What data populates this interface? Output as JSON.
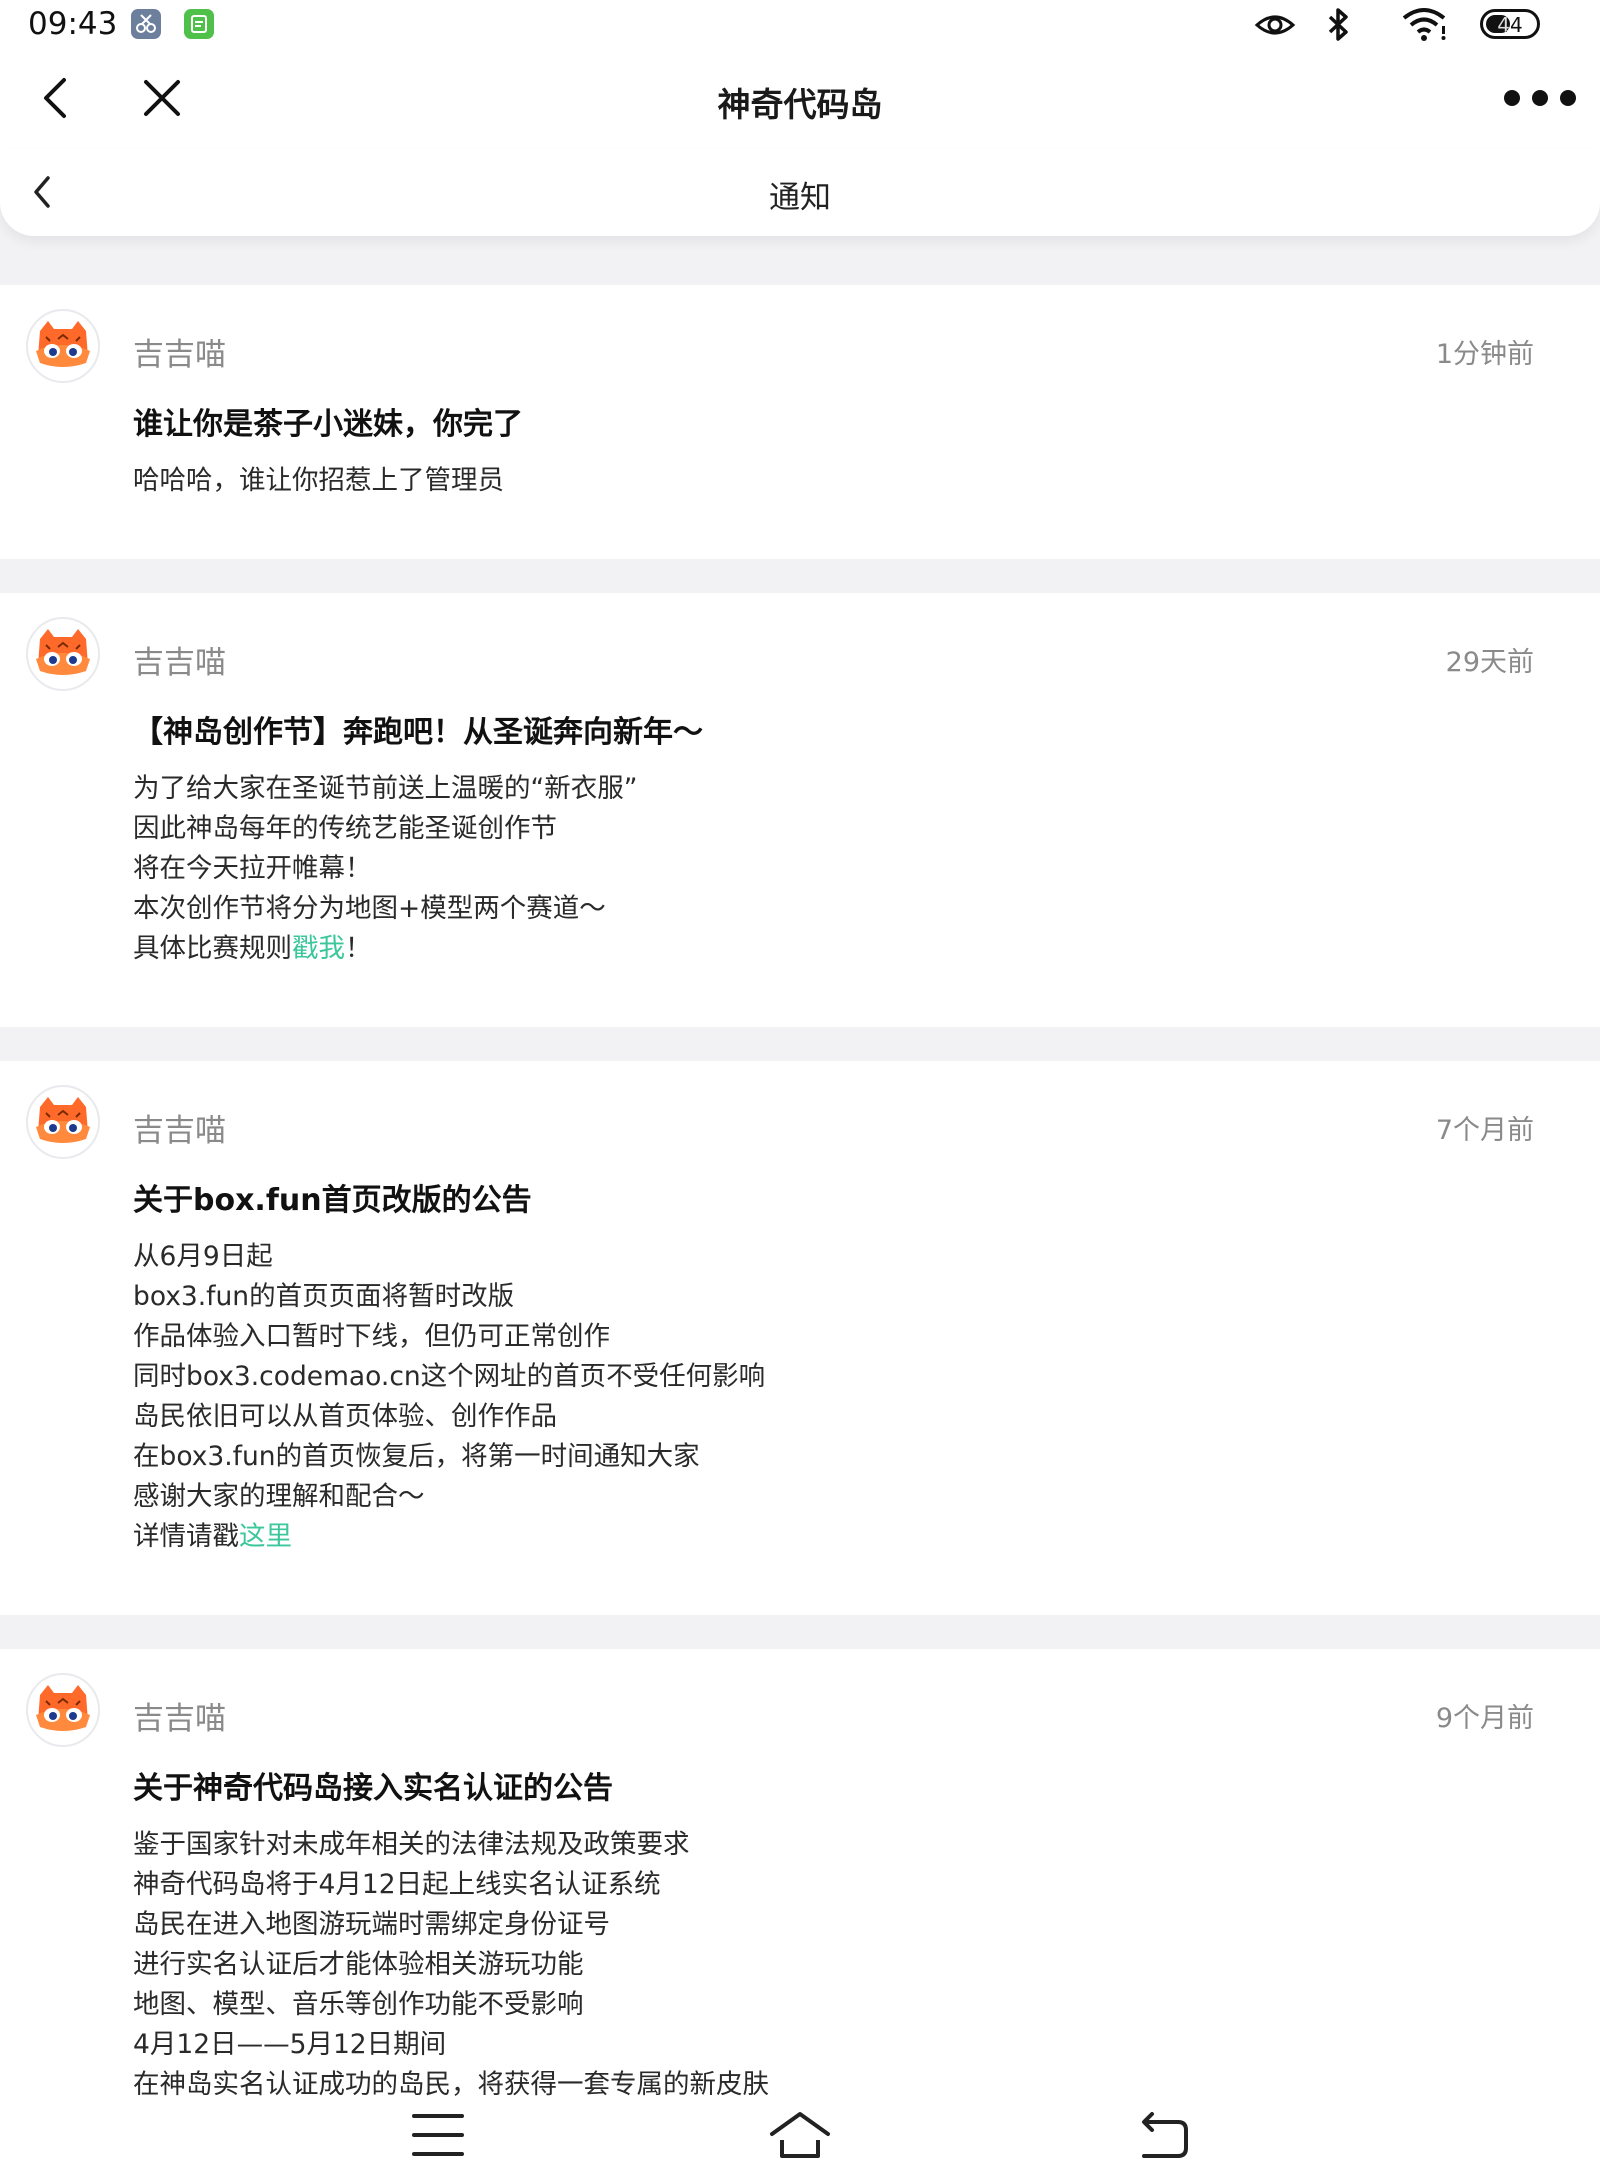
{
  "status_bar": {
    "time": "09:43",
    "battery": "44",
    "icons": [
      "scissors-app-icon",
      "green-app-icon",
      "eye-icon",
      "bluetooth-icon",
      "wifi-icon",
      "battery-icon"
    ]
  },
  "header": {
    "title": "神奇代码岛",
    "back_icon": "chevron-left-icon",
    "close_icon": "close-icon",
    "more_icon": "more-dots-icon"
  },
  "subheader": {
    "title": "通知",
    "back_icon": "chevron-left-icon"
  },
  "colors": {
    "link": "#3cc79b",
    "page_bg": "#f2f2f4",
    "meta_text": "#8a8a8a"
  },
  "notifications": [
    {
      "sender": "吉吉喵",
      "time": "1分钟前",
      "title": "谁让你是茶子小迷妹，你完了",
      "body": [
        {
          "text": "哈哈哈，谁让你招惹上了管理员"
        }
      ]
    },
    {
      "sender": "吉吉喵",
      "time": "29天前",
      "title": "【神岛创作节】奔跑吧！从圣诞奔向新年～",
      "body": [
        {
          "text": "为了给大家在圣诞节前送上温暖的“新衣服”"
        },
        {
          "text": "因此神岛每年的传统艺能圣诞创作节"
        },
        {
          "text": "将在今天拉开帷幕！"
        },
        {
          "text": "本次创作节将分为地图+模型两个赛道～"
        },
        {
          "pre": "具体比赛规则",
          "link": "戳我",
          "post": "！"
        }
      ]
    },
    {
      "sender": "吉吉喵",
      "time": "7个月前",
      "title": "关于box.fun首页改版的公告",
      "body": [
        {
          "text": "从6月9日起"
        },
        {
          "text": "box3.fun的首页页面将暂时改版"
        },
        {
          "text": "作品体验入口暂时下线，但仍可正常创作"
        },
        {
          "text": "同时box3.codemao.cn这个网址的首页不受任何影响"
        },
        {
          "text": "岛民依旧可以从首页体验、创作作品"
        },
        {
          "text": "在box3.fun的首页恢复后，将第一时间通知大家"
        },
        {
          "text": "感谢大家的理解和配合～"
        },
        {
          "pre": "详情请戳",
          "link": "这里",
          "post": ""
        }
      ]
    },
    {
      "sender": "吉吉喵",
      "time": "9个月前",
      "title": "关于神奇代码岛接入实名认证的公告",
      "body": [
        {
          "text": "鉴于国家针对未成年相关的法律法规及政策要求"
        },
        {
          "text": "神奇代码岛将于4月12日起上线实名认证系统"
        },
        {
          "text": "岛民在进入地图游玩端时需绑定身份证号"
        },
        {
          "text": "进行实名认证后才能体验相关游玩功能"
        },
        {
          "text": "地图、模型、音乐等创作功能不受影响"
        },
        {
          "text": "4月12日——5月12日期间"
        },
        {
          "text": "在神岛实名认证成功的岛民，将获得一套专属的新皮肤"
        }
      ]
    }
  ],
  "nav_bar": {
    "icons": [
      "menu-icon",
      "home-icon",
      "back-icon"
    ]
  }
}
